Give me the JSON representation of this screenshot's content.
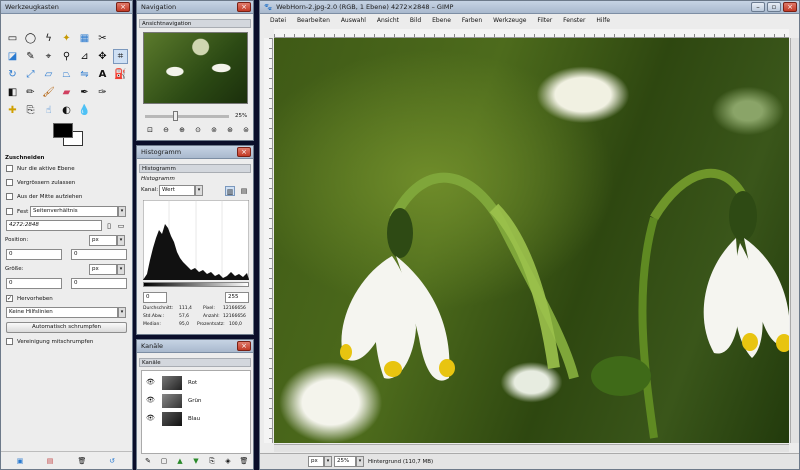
{
  "toolbox": {
    "title": "Werkzeugkasten",
    "options_title": "Zuschneiden",
    "only_active_layer": "Nur die aktive Ebene",
    "allow_enlarge": "Vergrössern zulassen",
    "from_center": "Aus der Mitte aufziehen",
    "fixed_label": "Fest",
    "fixed_value": "Seitenverhältnis",
    "ratio_value": "4272:2848",
    "position_label": "Position:",
    "position_unit": "px",
    "position_x": "0",
    "position_y": "0",
    "size_label": "Größe:",
    "size_unit": "px",
    "size_w": "0",
    "size_h": "0",
    "highlight_label": "Hervorheben",
    "guides_value": "Keine Hilfslinien",
    "auto_shrink": "Automatisch schrumpfen",
    "merge_visible": "Vereinigung mitschrumpfen"
  },
  "navigation": {
    "title": "Navigation",
    "dock_label": "Ansichtnavigation",
    "zoom_value": "25%"
  },
  "histogram": {
    "title": "Histogramm",
    "dock_label": "Histogramm",
    "sub_label": "Histogramm",
    "channel_label": "Kanal:",
    "channel_value": "Wert",
    "range_min": "0",
    "range_max": "255",
    "stats": {
      "mean_label": "Durchschnitt:",
      "mean_value": "111,4",
      "std_label": "Std.Abw.:",
      "std_value": "57,6",
      "median_label": "Median:",
      "median_value": "95,0",
      "pixels_label": "Pixel:",
      "pixels_value": "12166656",
      "count_label": "Anzahl:",
      "count_value": "12166656",
      "percentile_label": "Prozentsatz:",
      "percentile_value": "100,0"
    }
  },
  "channels": {
    "title": "Kanäle",
    "dock_label": "Kanäle",
    "items": [
      "Rot",
      "Grün",
      "Blau"
    ]
  },
  "image_window": {
    "title": "WebHorn-2.jpg-2.0 (RGB, 1 Ebene) 4272×2848 – GIMP",
    "menu": [
      "Datei",
      "Bearbeiten",
      "Auswahl",
      "Ansicht",
      "Bild",
      "Ebene",
      "Farben",
      "Werkzeuge",
      "Filter",
      "Fenster",
      "Hilfe"
    ],
    "unit_value": "px",
    "zoom_value": "25%",
    "status_text": "Hintergrund (110,7 MB)"
  },
  "colors": {
    "titlebar": "#b9c7d9",
    "panel": "#ededed",
    "desktop": "#0a0e2a"
  }
}
